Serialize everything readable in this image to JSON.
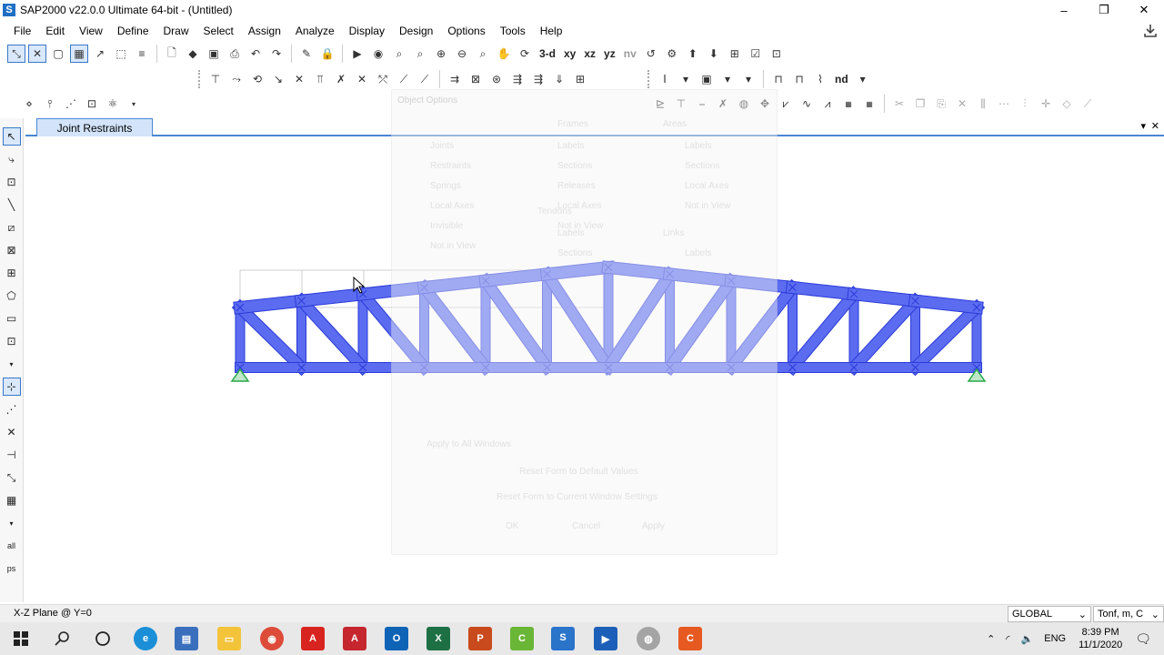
{
  "window": {
    "title": "SAP2000 v22.0.0 Ultimate 64-bit - (Untitled)",
    "icon_letter": "S",
    "minimize": "–",
    "restore": "❐",
    "close": "✕"
  },
  "menu": [
    "File",
    "Edit",
    "View",
    "Define",
    "Draw",
    "Select",
    "Assign",
    "Analyze",
    "Display",
    "Design",
    "Options",
    "Tools",
    "Help"
  ],
  "toolbar1": {
    "view_labels": [
      "3-d",
      "xy",
      "xz",
      "yz",
      "nv"
    ]
  },
  "toolbar2": {
    "text_label": "nd"
  },
  "tab": {
    "label": "Joint Restraints",
    "dropdown": "▾",
    "close": "✕"
  },
  "ghost_dialog": {
    "title": "Object Options",
    "labels": [
      "Joints",
      "Restraints",
      "Springs",
      "Local Axes",
      "Invisible",
      "Not in View",
      "Frames",
      "Labels",
      "Sections",
      "Releases",
      "Local Axes",
      "Not in View",
      "Tendons",
      "Labels",
      "Sections",
      "Areas",
      "Labels",
      "Sections",
      "Local Axes",
      "Not in View",
      "Links",
      "Labels",
      "Apply to All Windows",
      "Reset Form to Default Values",
      "Reset Form to Current Window Settings",
      "OK",
      "Cancel",
      "Apply"
    ]
  },
  "status": {
    "plane": "X-Z Plane @ Y=0",
    "coord_system": "GLOBAL",
    "units": "Tonf, m, C"
  },
  "taskbar": {
    "language": "ENG",
    "time": "8:39 PM",
    "date": "11/1/2020"
  },
  "colors": {
    "truss_fill": "#5b6cf0",
    "truss_edge": "#2a3ad8",
    "support": "#2aa84a",
    "tab_accent": "#4a86d4"
  }
}
